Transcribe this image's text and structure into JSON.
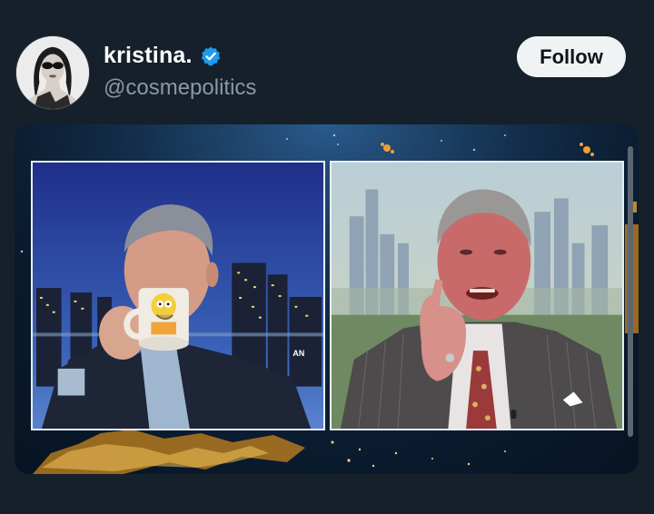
{
  "post": {
    "display_name": "kristina.",
    "handle": "@cosmepolitics",
    "follow_label": "Follow",
    "verified": true,
    "avatar_icon": "profile-photo-woman-sunglasses",
    "verified_icon": "verified-badge-icon"
  },
  "media": {
    "left_panel_badge": "AN",
    "left_panel_description": "",
    "right_panel_description": ""
  },
  "colors": {
    "background": "#15202b",
    "handle": "#8b98a5",
    "verified": "#1d9bf0",
    "follow_bg": "#eff3f4"
  }
}
